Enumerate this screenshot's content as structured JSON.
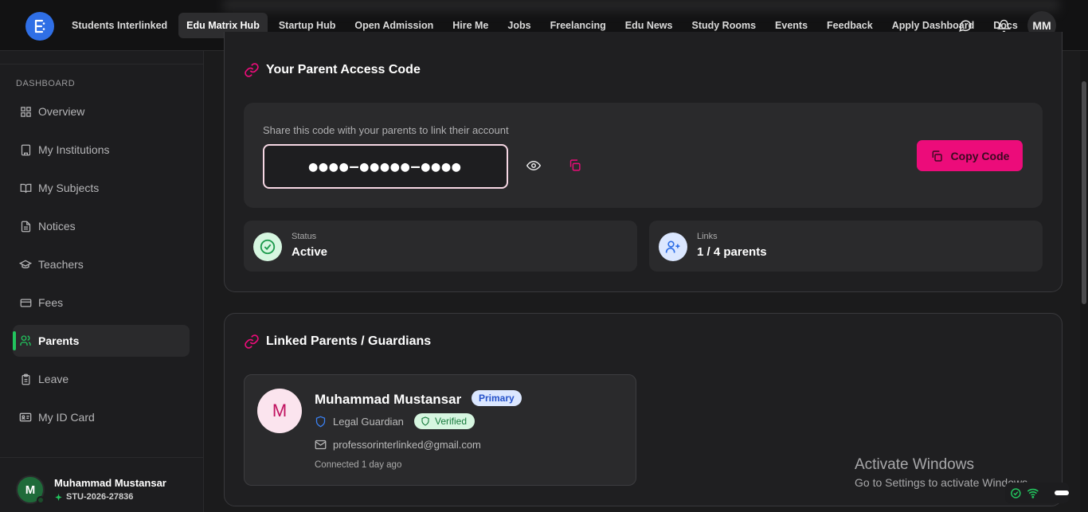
{
  "nav": {
    "items": [
      "Students Interlinked",
      "Edu Matrix Hub",
      "Startup Hub",
      "Open Admission",
      "Hire Me",
      "Jobs",
      "Freelancing",
      "Edu News",
      "Study Rooms",
      "Events",
      "Feedback",
      "Apply Dashboard",
      "Docs"
    ],
    "active_index": 1,
    "user_initials": "MM"
  },
  "sidebar": {
    "section_title": "DASHBOARD",
    "items": [
      {
        "label": "Overview",
        "icon": "grid-icon"
      },
      {
        "label": "My Institutions",
        "icon": "building-icon"
      },
      {
        "label": "My Subjects",
        "icon": "book-open-icon"
      },
      {
        "label": "Notices",
        "icon": "file-text-icon"
      },
      {
        "label": "Teachers",
        "icon": "graduation-cap-icon"
      },
      {
        "label": "Fees",
        "icon": "wallet-icon"
      },
      {
        "label": "Parents",
        "icon": "users-icon"
      },
      {
        "label": "Leave",
        "icon": "clipboard-icon"
      },
      {
        "label": "My ID Card",
        "icon": "id-card-icon"
      }
    ],
    "active_index": 6,
    "user": {
      "initial": "M",
      "name": "Muhammad Mustansar",
      "id": "STU-2026-27836"
    }
  },
  "access_code": {
    "title": "Your Parent Access Code",
    "hint": "Share this code with your parents to link their account",
    "masked_code": "●●●●–●●●●●–●●●●",
    "copy_label": "Copy Code",
    "status_label": "Status",
    "status_value": "Active",
    "links_label": "Links",
    "links_value": "1 / 4 parents"
  },
  "linked": {
    "title": "Linked Parents / Guardians",
    "parent": {
      "initial": "M",
      "name": "Muhammad Mustansar",
      "badge": "Primary",
      "role": "Legal Guardian",
      "verified": "Verified",
      "email": "professorinterlinked@gmail.com",
      "connected": "Connected 1 day ago"
    }
  },
  "watermark": {
    "line1": "Activate Windows",
    "line2": "Go to Settings to activate Windows."
  },
  "colors": {
    "accent": "#ec0c7a",
    "active_green": "#22c55e",
    "logo_blue": "#2f6fe6"
  }
}
